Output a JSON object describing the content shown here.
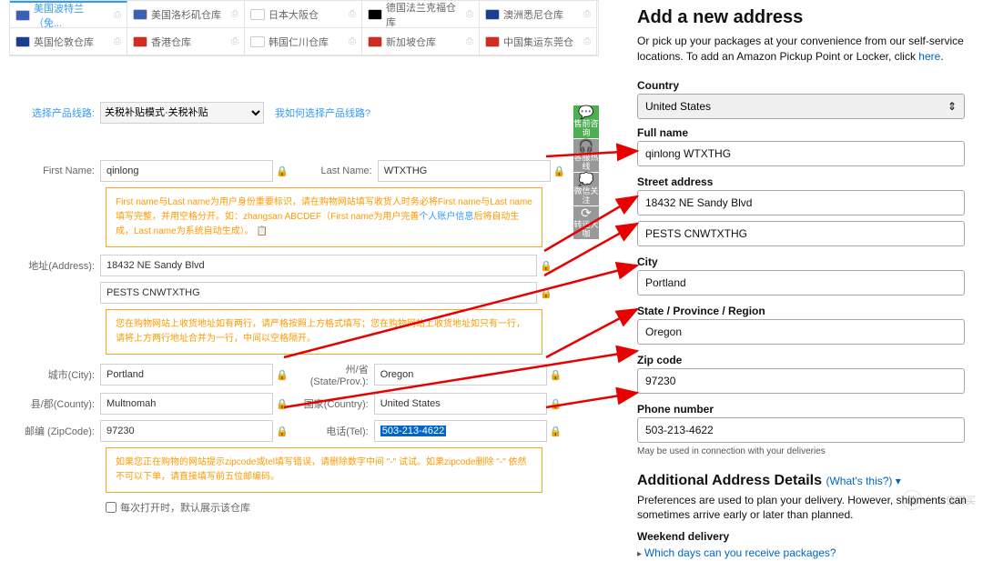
{
  "tabs": [
    {
      "label": "美国波特兰（免...",
      "flag": "#3a5fb5",
      "active": true
    },
    {
      "label": "美国洛杉矶仓库",
      "flag": "#3a5fb5"
    },
    {
      "label": "日本大阪仓",
      "flag": "#fff"
    },
    {
      "label": "德国法兰克福仓库",
      "flag": "#000"
    },
    {
      "label": "澳洲悉尼仓库",
      "flag": "#1a3f8f"
    },
    {
      "label": "英国伦敦仓库",
      "flag": "#1a3f8f"
    },
    {
      "label": "香港仓库",
      "flag": "#d52b1e"
    },
    {
      "label": "韩国仁川仓库",
      "flag": "#fff"
    },
    {
      "label": "新加坡仓库",
      "flag": "#d52b1e"
    },
    {
      "label": "中国集运东莞仓",
      "flag": "#d52b1e"
    }
  ],
  "route": {
    "label": "选择产品线路:",
    "value": "关税补贴模式·关税补贴",
    "help": "我如何选择产品线路?"
  },
  "form": {
    "first_name": {
      "label": "First Name:",
      "value": "qinlong"
    },
    "last_name": {
      "label": "Last Name:",
      "value": "WTXTHG"
    },
    "name_hint_1": "First name与Last name为用户身份重要标识，请在购物网站填写收货人时务必将First name与Last name填写完整，并用空格分开。如：zhangsan ABCDEF（First name为用户完善",
    "name_hint_link": "个人账户信息",
    "name_hint_2": "后将自动生成，Last name为系统自动生成）。",
    "address": {
      "label": "地址(Address):",
      "value1": "18432 NE Sandy Blvd",
      "value2": "PESTS CNWTXTHG"
    },
    "address_hint": "您在购物网站上收货地址如有两行，请严格按照上方格式填写；您在购物网站上收货地址如只有一行，请将上方两行地址合并为一行，中间以空格隔开。",
    "city": {
      "label": "城市(City):",
      "value": "Portland"
    },
    "state": {
      "label": "州/省(State/Prov.):",
      "value": "Oregon"
    },
    "county": {
      "label": "县/郡(County):",
      "value": "Multnomah"
    },
    "country": {
      "label": "国家(Country):",
      "value": "United States"
    },
    "zip": {
      "label": "邮编 (ZipCode):",
      "value": "97230"
    },
    "tel": {
      "label": "电话(Tel):",
      "value": "503-213-4622"
    },
    "zip_hint": "如果您正在购物的网站提示zipcode或tel填写错误，请删除数字中间 \"-\" 试试。如果zipcode删除 \"-\" 依然不可以下单，请直接填写前五位邮编码。",
    "checkbox": "每次打开时，默认展示该仓库"
  },
  "sidebar": [
    {
      "icon": "💬",
      "label": "售前咨询",
      "cls": "green"
    },
    {
      "icon": "🎧",
      "label": "客服热线"
    },
    {
      "icon": "💭",
      "label": "微信关注"
    },
    {
      "icon": "⟳",
      "label": "转运大咖"
    }
  ],
  "right": {
    "title": "Add a new address",
    "sub1": "Or pick up your packages at your convenience from our self-service locations. To add an Amazon Pickup Point or Locker, click ",
    "sub_link": "here",
    "country": {
      "label": "Country",
      "value": "United States"
    },
    "full_name": {
      "label": "Full name",
      "value": "qinlong WTXTHG"
    },
    "street": {
      "label": "Street address",
      "value1": "18432 NE Sandy Blvd",
      "value2": "PESTS CNWTXTHG"
    },
    "city": {
      "label": "City",
      "value": "Portland"
    },
    "state": {
      "label": "State / Province / Region",
      "value": "Oregon"
    },
    "zip": {
      "label": "Zip code",
      "value": "97230"
    },
    "phone": {
      "label": "Phone number",
      "value": "503-213-4622",
      "note": "May be used in connection with your deliveries"
    },
    "addl": {
      "title": "Additional Address Details",
      "whats": "(What's this?)",
      "arrow": "▾",
      "desc": "Preferences are used to plan your delivery. However, shipments can sometimes arrive early or later than planned.",
      "weekend": "Weekend delivery",
      "which": "Which days can you receive packages?"
    }
  },
  "watermark": "什么值得买"
}
